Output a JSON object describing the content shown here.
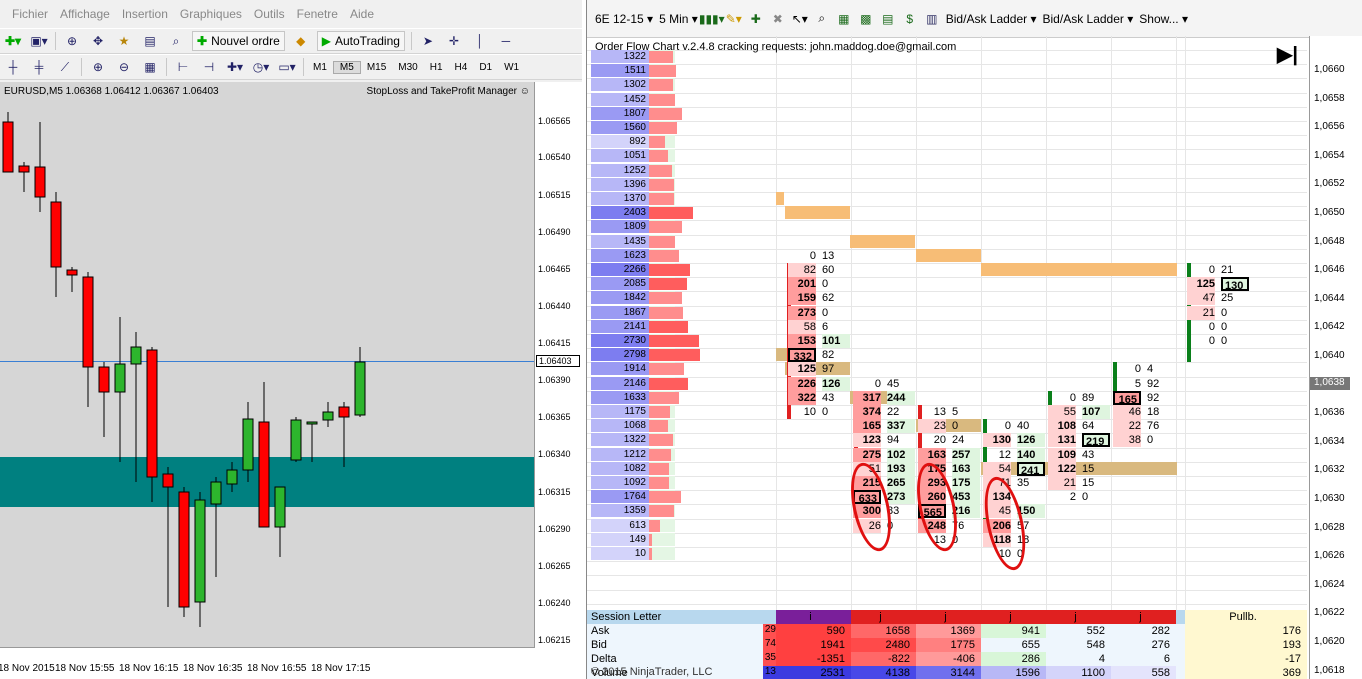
{
  "mt4": {
    "menu": [
      "Fichier",
      "Affichage",
      "Insertion",
      "Graphiques",
      "Outils",
      "Fenetre",
      "Aide"
    ],
    "toolbar": {
      "new_order": "Nouvel ordre",
      "autotrading": "AutoTrading"
    },
    "timeframes": [
      "M1",
      "M5",
      "M15",
      "M30",
      "H1",
      "H4",
      "D1",
      "W1"
    ],
    "active_timeframe": "M5",
    "chart": {
      "symbol_line": "EURUSD,M5  1.06368 1.06412 1.06367 1.06403",
      "ea_label": "StopLoss and TakeProfit Manager ☺",
      "y_ticks": [
        "1.06565",
        "1.06540",
        "1.06515",
        "1.06490",
        "1.06465",
        "1.06440",
        "1.06415",
        "1.06390",
        "1.06365",
        "1.06340",
        "1.06315",
        "1.06290",
        "1.06265",
        "1.06240",
        "1.06215"
      ],
      "current_price": "1.06403",
      "x_ticks": [
        "18 Nov 2015",
        "18 Nov 15:55",
        "18 Nov 16:15",
        "18 Nov 16:35",
        "18 Nov 16:55",
        "18 Nov 17:15"
      ],
      "up_color": "#2db52d",
      "down_color": "#ff0000"
    }
  },
  "nt": {
    "instrument": "6E 12-15",
    "period": "5 Min",
    "bidask1": "Bid/Ask Ladder",
    "bidask2": "Bid/Ask Ladder",
    "show": "Show...",
    "header": "Order Flow Chart v.2.4.8       cracking requests: john.maddog.doe@gmail.com",
    "y_ticks": [
      "1,0660",
      "1,0658",
      "1,0656",
      "1,0654",
      "1,0652",
      "1,0650",
      "1,0648",
      "1,0646",
      "1,0644",
      "1,0642",
      "1,0640",
      "1,0638",
      "1,0636",
      "1,0634",
      "1,0632",
      "1,0630",
      "1,0628",
      "1,0626",
      "1,0624",
      "1,0622",
      "1,0620",
      "1,0618"
    ],
    "current_price": "1,0638",
    "profile": [
      "1322",
      "1511",
      "1302",
      "1452",
      "1807",
      "1560",
      "892",
      "1051",
      "1252",
      "1396",
      "1370",
      "2403",
      "1809",
      "1435",
      "1623",
      "2266",
      "2085",
      "1842",
      "1867",
      "2141",
      "2730",
      "2798",
      "1914",
      "2146",
      "1633",
      "1175",
      "1068",
      "1322",
      "1212",
      "1082",
      "1092",
      "1764",
      "1359",
      "613",
      "149",
      "10"
    ],
    "bars": [
      {
        "rows": [
          [
            "0",
            "13"
          ],
          [
            "82",
            "60"
          ],
          [
            "201",
            "0"
          ],
          [
            "159",
            "62"
          ],
          [
            "273",
            "0"
          ],
          [
            "58",
            "6"
          ],
          [
            "153",
            "101"
          ],
          [
            "332",
            "82"
          ],
          [
            "125",
            "97"
          ],
          [
            "226",
            "126"
          ],
          [
            "322",
            "43"
          ],
          [
            "10",
            "0"
          ]
        ]
      },
      {
        "rows": [
          [
            "0",
            "45"
          ],
          [
            "317",
            "244"
          ],
          [
            "374",
            "22"
          ],
          [
            "165",
            "337"
          ],
          [
            "123",
            "94"
          ],
          [
            "275",
            "102"
          ],
          [
            "51",
            "193"
          ],
          [
            "215",
            "265"
          ],
          [
            "633",
            "273"
          ],
          [
            "300",
            "83"
          ],
          [
            "26",
            "0"
          ]
        ]
      },
      {
        "rows": [
          [
            "13",
            "5"
          ],
          [
            "23",
            "0"
          ],
          [
            "20",
            "24"
          ],
          [
            "163",
            "257"
          ],
          [
            "175",
            "163"
          ],
          [
            "293",
            "175"
          ],
          [
            "260",
            "453"
          ],
          [
            "565",
            "216"
          ],
          [
            "248",
            "76"
          ],
          [
            "13",
            "0"
          ]
        ]
      },
      {
        "rows": [
          [
            "0",
            "40"
          ],
          [
            "130",
            "126"
          ],
          [
            "12",
            "140"
          ],
          [
            "54",
            "241"
          ],
          [
            "71",
            "35"
          ],
          [
            "134"
          ],
          [
            "45",
            "150"
          ],
          [
            "206",
            "57"
          ],
          [
            "118",
            "18"
          ],
          [
            "10",
            "0"
          ]
        ]
      },
      {
        "rows": [
          [
            "0",
            "89"
          ],
          [
            "55",
            "107"
          ],
          [
            "108",
            "64"
          ],
          [
            "131",
            "219"
          ],
          [
            "109",
            "43"
          ],
          [
            "122",
            "15"
          ],
          [
            "21",
            "15"
          ],
          [
            "2",
            "0"
          ]
        ]
      },
      {
        "rows": [
          [
            "0",
            "4"
          ],
          [
            "5",
            "92"
          ],
          [
            "165",
            "92"
          ],
          [
            "46",
            "18"
          ],
          [
            "22",
            "76"
          ],
          [
            "38",
            "0"
          ]
        ]
      },
      {
        "rows": [
          [
            "0",
            "21"
          ],
          [
            "125",
            "130"
          ],
          [
            "47",
            "25"
          ],
          [
            "21",
            "0"
          ],
          [
            "0",
            "0"
          ],
          [
            "0",
            "0"
          ]
        ]
      }
    ],
    "stats": {
      "labels": [
        "Session Letter",
        "Ask",
        "Bid",
        "Delta",
        "Volume"
      ],
      "letters": [
        "i",
        "j",
        "j",
        "j",
        "j",
        "j"
      ],
      "pullb_label": "Pullb.",
      "ask": [
        "590",
        "1658",
        "1369",
        "941",
        "552",
        "282",
        "176"
      ],
      "bid": [
        "1941",
        "2480",
        "1775",
        "655",
        "548",
        "276",
        "193"
      ],
      "delta": [
        "-1351",
        "-822",
        "-406",
        "286",
        "4",
        "6",
        "-17"
      ],
      "volume": [
        "2531",
        "4138",
        "3144",
        "1596",
        "1100",
        "558",
        "369"
      ],
      "partial": [
        "29",
        "74",
        "35",
        "13"
      ],
      "copyright": "© 2015 NinjaTrader, LLC"
    }
  }
}
